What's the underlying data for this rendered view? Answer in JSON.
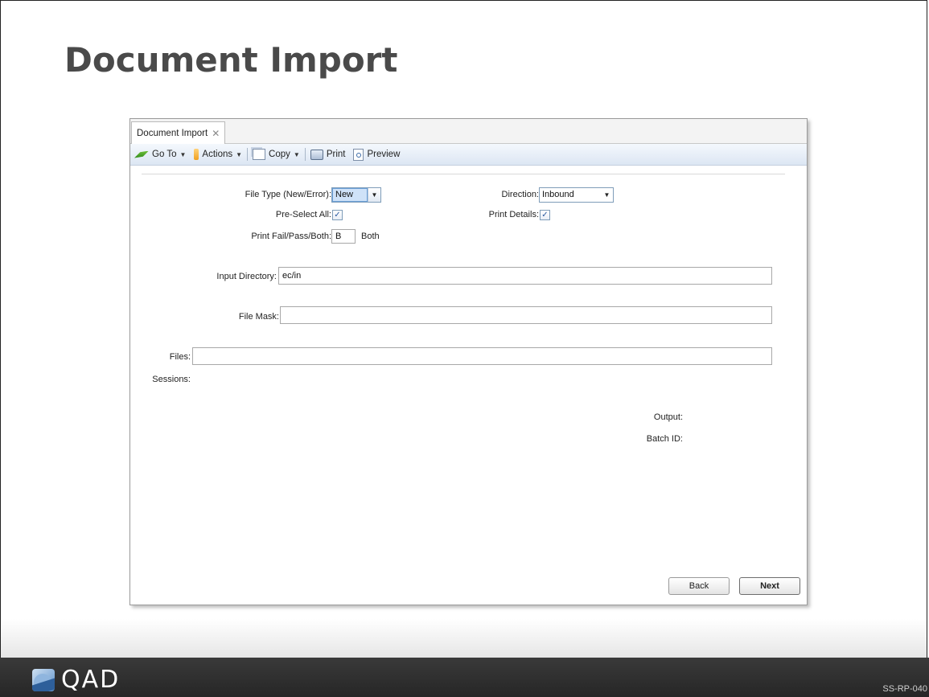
{
  "slide": {
    "title": "Document Import",
    "brand": "QAD",
    "code": "SS-RP-040"
  },
  "window": {
    "tab_label": "Document Import",
    "tab_close": "✕",
    "toolbar": {
      "goto": "Go To",
      "actions": "Actions",
      "copy": "Copy",
      "print": "Print",
      "preview": "Preview",
      "caret": "▼"
    },
    "form": {
      "file_type_label": "File Type (New/Error):",
      "file_type_value": "New",
      "direction_label": "Direction:",
      "direction_value": "Inbound",
      "preselect_label": "Pre-Select All:",
      "preselect_checked": true,
      "print_details_label": "Print Details:",
      "print_details_checked": true,
      "print_fail_label": "Print Fail/Pass/Both:",
      "print_fail_value": "B",
      "print_fail_desc": "Both",
      "input_dir_label": "Input Directory:",
      "input_dir_value": "ec/in",
      "file_mask_label": "File Mask:",
      "file_mask_value": "",
      "files_label": "Files:",
      "files_value": "",
      "sessions_label": "Sessions:",
      "output_label": "Output:",
      "batch_id_label": "Batch ID:",
      "check_mark": "✓",
      "dropdown_arrow": "▼"
    },
    "buttons": {
      "back": "Back",
      "next": "Next"
    }
  },
  "icons": [
    "goto-icon",
    "actions-icon",
    "copy-icon",
    "print-icon",
    "preview-icon",
    "close-icon",
    "chevron-down-icon",
    "qad-logo-icon"
  ]
}
